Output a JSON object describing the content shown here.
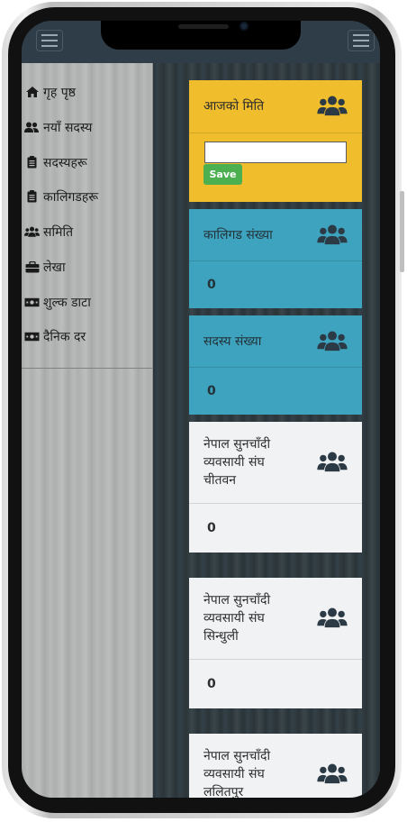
{
  "sidebar": {
    "items": [
      {
        "label": "गृह पृष्ठ",
        "icon": "home-icon"
      },
      {
        "label": "नयाँ सदस्य",
        "icon": "user-plus-icon"
      },
      {
        "label": "सदस्यहरू",
        "icon": "clipboard-icon"
      },
      {
        "label": "कालिगडहरू",
        "icon": "clipboard-icon"
      },
      {
        "label": "समिति",
        "icon": "users-icon"
      },
      {
        "label": "लेखा",
        "icon": "briefcase-icon"
      },
      {
        "label": "शुल्क डाटा",
        "icon": "money-icon"
      },
      {
        "label": "दैनिक दर",
        "icon": "money-icon"
      }
    ]
  },
  "cards": {
    "today": {
      "title": "आजको मिति",
      "input_value": "",
      "save_label": "Save"
    },
    "artisans": {
      "title": "कालिगड संख्या",
      "count": "0"
    },
    "members": {
      "title": "सदस्य संख्या",
      "count": "0"
    },
    "chitwan": {
      "title_lines": [
        "नेपाल सुनचाँदी",
        "व्यवसायी संघ",
        "चीतवन"
      ],
      "count": "0"
    },
    "sindhuli": {
      "title_lines": [
        "नेपाल सुनचाँदी",
        "व्यवसायी संघ",
        "सिन्धुली"
      ],
      "count": "0"
    },
    "lalitpur": {
      "title_lines": [
        "नेपाल सुनचाँदी",
        "व्यवसायी संघ",
        "ललितपुर"
      ]
    }
  },
  "colors": {
    "yellow": "#f0bd2c",
    "teal": "#3ea3bf",
    "light": "#f1f2f4",
    "save": "#4caf50",
    "topbar": "#2f3d48"
  }
}
